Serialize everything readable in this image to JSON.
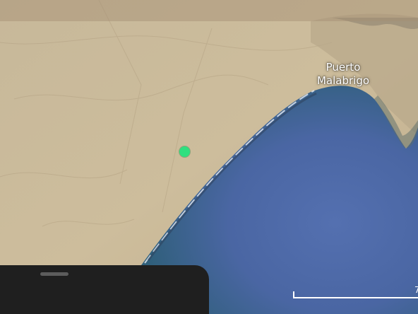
{
  "map": {
    "place_label": {
      "line1": "Puerto",
      "line2": "Malabrigo"
    },
    "scale": {
      "text": "7"
    },
    "colors": {
      "land": "#c9b99a",
      "ocean": "#4a6aa8",
      "location_dot": "#2fe07f",
      "sheet": "#1f1f1f"
    },
    "icons": {
      "location_marker": "current-location-dot"
    }
  }
}
